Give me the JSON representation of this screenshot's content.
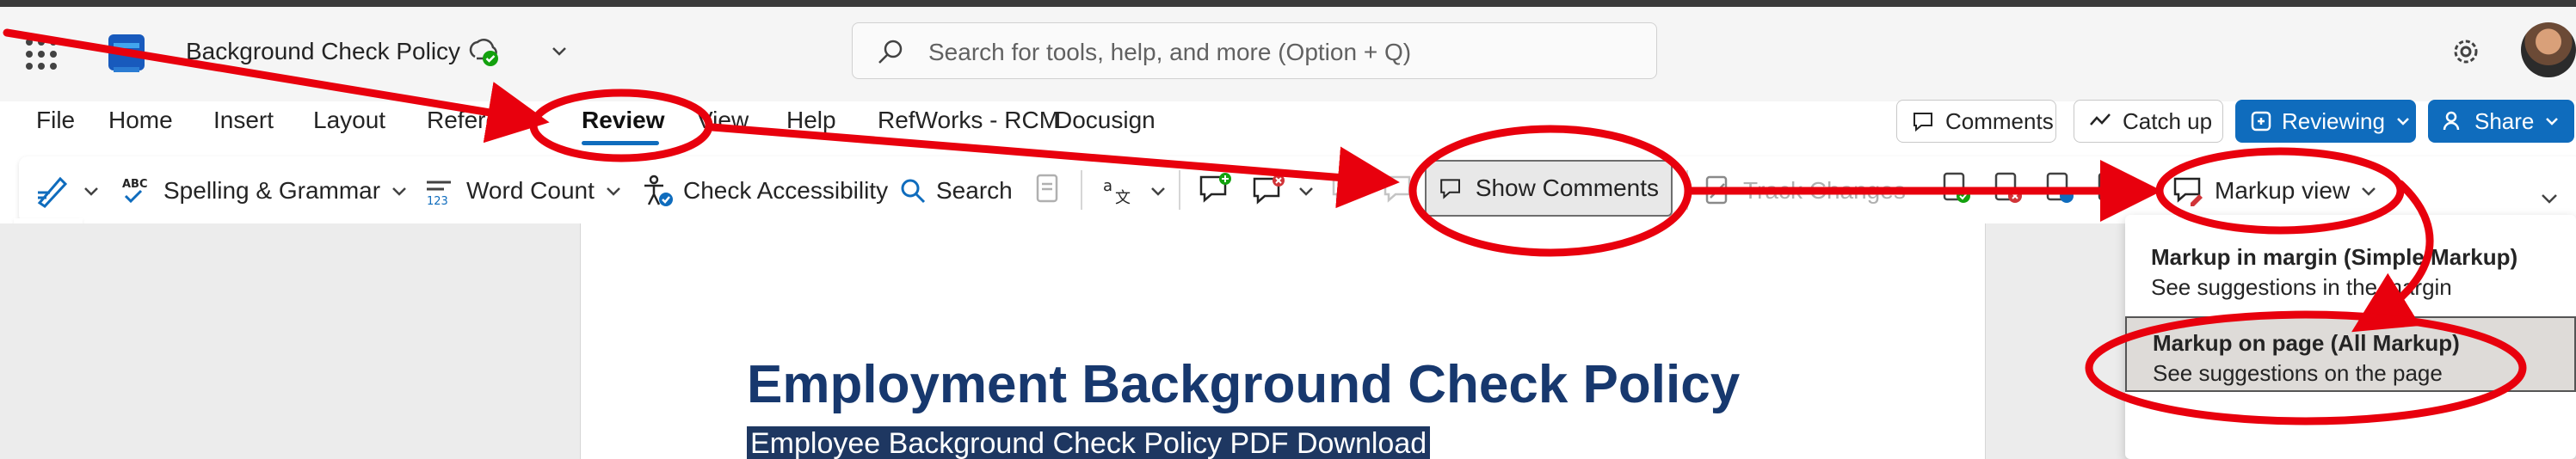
{
  "window": {
    "doc_title": "Background Check Policy",
    "search_placeholder": "Search for tools, help, and more (Option + Q)"
  },
  "menu": {
    "tabs": [
      "File",
      "Home",
      "Insert",
      "Layout",
      "Referen",
      "Review",
      "View",
      "Help",
      "RefWorks - RCM",
      "Docusign"
    ],
    "active_tab": "Review"
  },
  "header_buttons": {
    "comments": "Comments",
    "catch_up": "Catch up",
    "reviewing": "Reviewing",
    "share": "Share"
  },
  "ribbon": {
    "spelling": "Spelling & Grammar",
    "word_count": "Word Count",
    "check_accessibility": "Check Accessibility",
    "search": "Search",
    "show_comments": "Show Comments",
    "track_changes": "Track Changes",
    "markup_view": "Markup view"
  },
  "markup_menu": {
    "options": [
      {
        "title": "Markup in margin (Simple Markup)",
        "desc": "See suggestions in the margin",
        "selected": false
      },
      {
        "title": "Markup on page (All Markup)",
        "desc": "See suggestions on the page",
        "selected": true
      }
    ]
  },
  "document": {
    "heading": "Employment Background Check Policy",
    "subheading": "Employee Background Check Policy PDF Download"
  },
  "colors": {
    "accent": "#0f6cbd",
    "annotation": "#e8000d",
    "heading": "#17386e",
    "selection_bg": "#1e3761"
  },
  "icons": [
    "app-launcher-icon",
    "word-logo-icon",
    "synced-check-icon",
    "search-icon",
    "settings-gear-icon",
    "editor-pen-icon",
    "spelling-icon",
    "word-count-icon",
    "accessibility-icon",
    "ribbon-search-icon",
    "comment-icon",
    "track-changes-icon",
    "markup-view-icon",
    "chevron-down-icon"
  ]
}
